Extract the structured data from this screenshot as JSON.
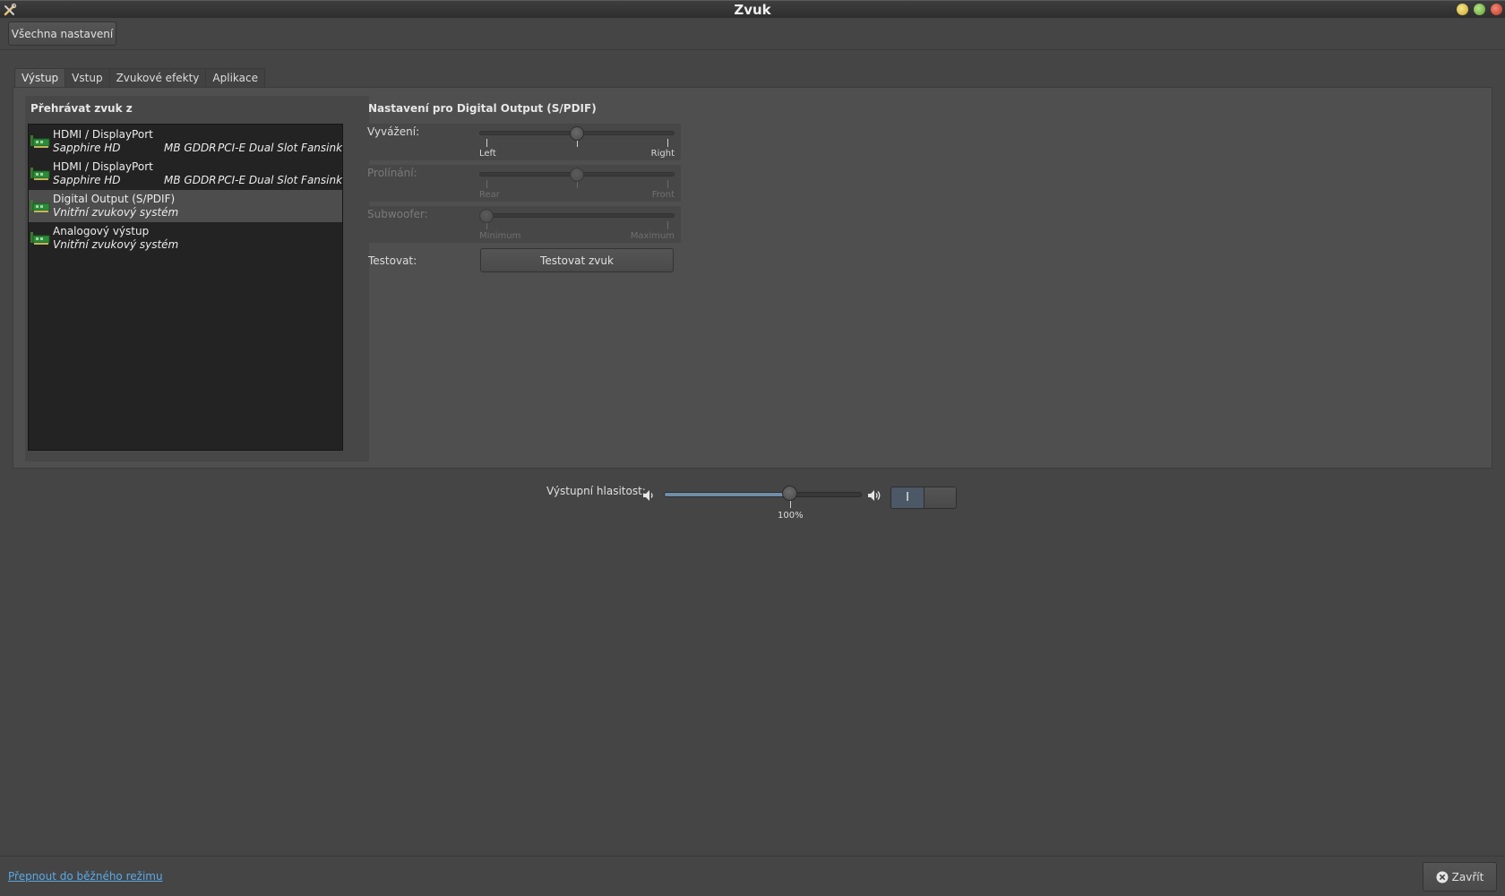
{
  "window": {
    "title": "Zvuk"
  },
  "toolbar": {
    "all_settings_label": "Všechna nastavení"
  },
  "tabs": [
    {
      "label": "Výstup",
      "active": true
    },
    {
      "label": "Vstup",
      "active": false
    },
    {
      "label": "Zvukové efekty",
      "active": false
    },
    {
      "label": "Aplikace",
      "active": false
    }
  ],
  "output": {
    "list_title": "Přehrávat zvuk z",
    "devices": [
      {
        "name": "HDMI / DisplayPort",
        "desc": "Sapphire HD",
        "desc2": "MB GDDR",
        "desc3": "PCI-E Dual Slot Fansink",
        "selected": false
      },
      {
        "name": "HDMI / DisplayPort",
        "desc": "Sapphire HD",
        "desc2": "MB GDDR",
        "desc3": "PCI-E Dual Slot Fansink",
        "selected": false
      },
      {
        "name": "Digital Output (S/PDIF)",
        "desc": "Vnitřní zvukový systém",
        "selected": true
      },
      {
        "name": "Analogový výstup",
        "desc": "Vnitřní zvukový systém",
        "selected": false
      }
    ],
    "settings_title": "Nastavení pro Digital Output (S/PDIF)",
    "balance": {
      "label": "Vyvážení:",
      "left": "Left",
      "right": "Right",
      "value": 0.5
    },
    "fade": {
      "label": "Prolínání:",
      "left": "Rear",
      "right": "Front",
      "value": 0.5
    },
    "subwoofer": {
      "label": "Subwoofer:",
      "left": "Minimum",
      "right": "Maximum",
      "value": 0.0
    },
    "test_label": "Testovat:",
    "test_button": "Testovat zvuk"
  },
  "volume": {
    "label": "Výstupní hlasitost:",
    "percent_label": "100%",
    "level": 0.64,
    "toggle_on_label": "I",
    "accent": "#6f8ea8"
  },
  "bottom": {
    "mode_link": "Přepnout do běžného režimu",
    "close_label": "Zavřít"
  }
}
